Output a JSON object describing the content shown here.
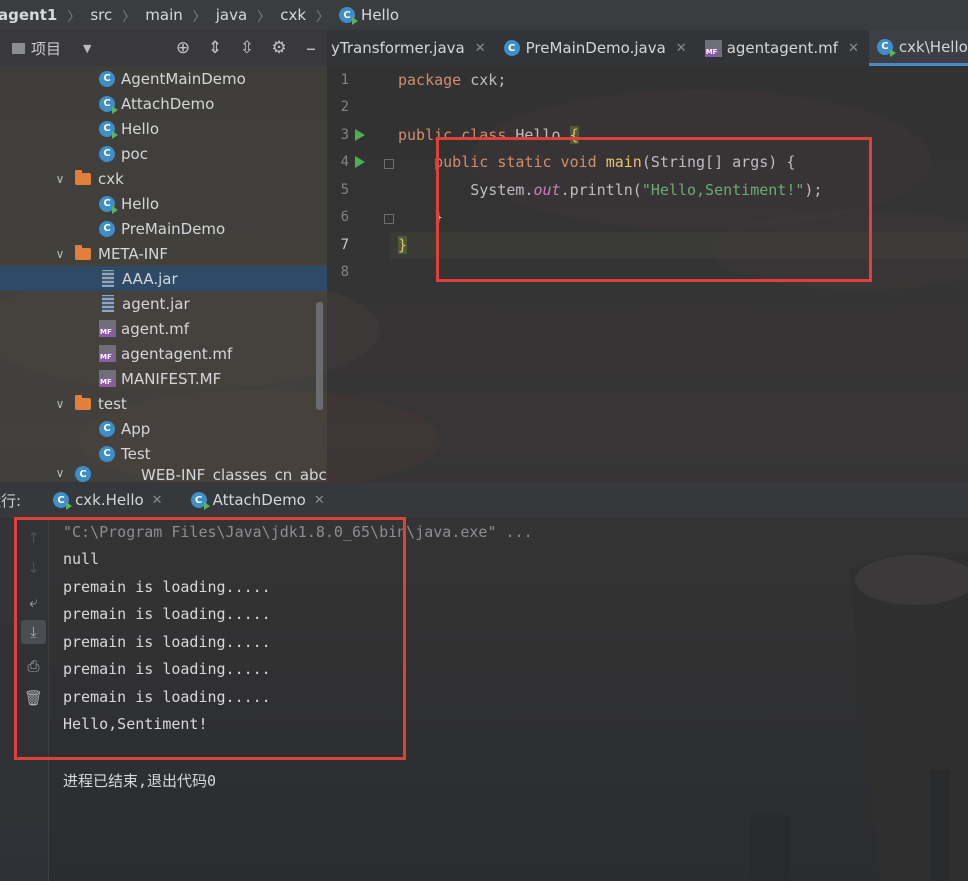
{
  "breadcrumb": [
    "agent1",
    "src",
    "main",
    "java",
    "cxk",
    "Hello"
  ],
  "project_panel": {
    "title": "项目"
  },
  "tree": [
    {
      "label": "AgentMainDemo",
      "kind": "class"
    },
    {
      "label": "AttachDemo",
      "kind": "class"
    },
    {
      "label": "Hello",
      "kind": "class"
    },
    {
      "label": "poc",
      "kind": "class"
    },
    {
      "label": "cxk",
      "kind": "folder"
    },
    {
      "label": "Hello",
      "kind": "class"
    },
    {
      "label": "PreMainDemo",
      "kind": "class"
    },
    {
      "label": "META-INF",
      "kind": "folder"
    },
    {
      "label": "AAA.jar",
      "kind": "jar",
      "selected": true
    },
    {
      "label": "agent.jar",
      "kind": "jar"
    },
    {
      "label": "agent.mf",
      "kind": "mf"
    },
    {
      "label": "agentagent.mf",
      "kind": "mf"
    },
    {
      "label": "MANIFEST.MF",
      "kind": "mf"
    },
    {
      "label": "test",
      "kind": "folder"
    },
    {
      "label": "App",
      "kind": "class"
    },
    {
      "label": "Test",
      "kind": "class"
    },
    {
      "label": "WEB-INF_classes_cn_abc",
      "kind": "class"
    }
  ],
  "editor_tabs": [
    {
      "label": "yTransformer.java"
    },
    {
      "label": "PreMainDemo.java"
    },
    {
      "label": "agentagent.mf"
    },
    {
      "label": "cxk\\Hello.java",
      "active": true
    }
  ],
  "line_numbers": [
    "1",
    "2",
    "3",
    "4",
    "5",
    "6",
    "7",
    "8"
  ],
  "code": {
    "l1_kw": "package",
    "l1_rest": " cxk;",
    "l3_kw": "public class",
    "l3_name": " Hello ",
    "l3_brace": "{",
    "l4_kw": "    public static void",
    "l4_fn": " main",
    "l4_rest": "(String[] args) {",
    "l5_a": "        System.",
    "l5_out": "out",
    "l5_b": ".println(",
    "l5_str": "\"Hello,Sentiment!\"",
    "l5_c": ");",
    "l6": "    }",
    "l7": "}"
  },
  "run_panel": {
    "label": "运行:",
    "tabs": [
      {
        "label": "cxk.Hello"
      },
      {
        "label": "AttachDemo"
      }
    ]
  },
  "console": [
    "\"C:\\Program Files\\Java\\jdk1.8.0_65\\bin\\java.exe\" ...",
    "null",
    "premain is loading.....",
    "premain is loading.....",
    "premain is loading.....",
    "premain is loading.....",
    "premain is loading.....",
    "Hello,Sentiment!",
    "",
    "进程已结束,退出代码0"
  ],
  "colors": {
    "highlight_box": "#e0403a",
    "accent": "#4a88c7",
    "keyword": "#cf8e6d",
    "string": "#6aab73"
  }
}
